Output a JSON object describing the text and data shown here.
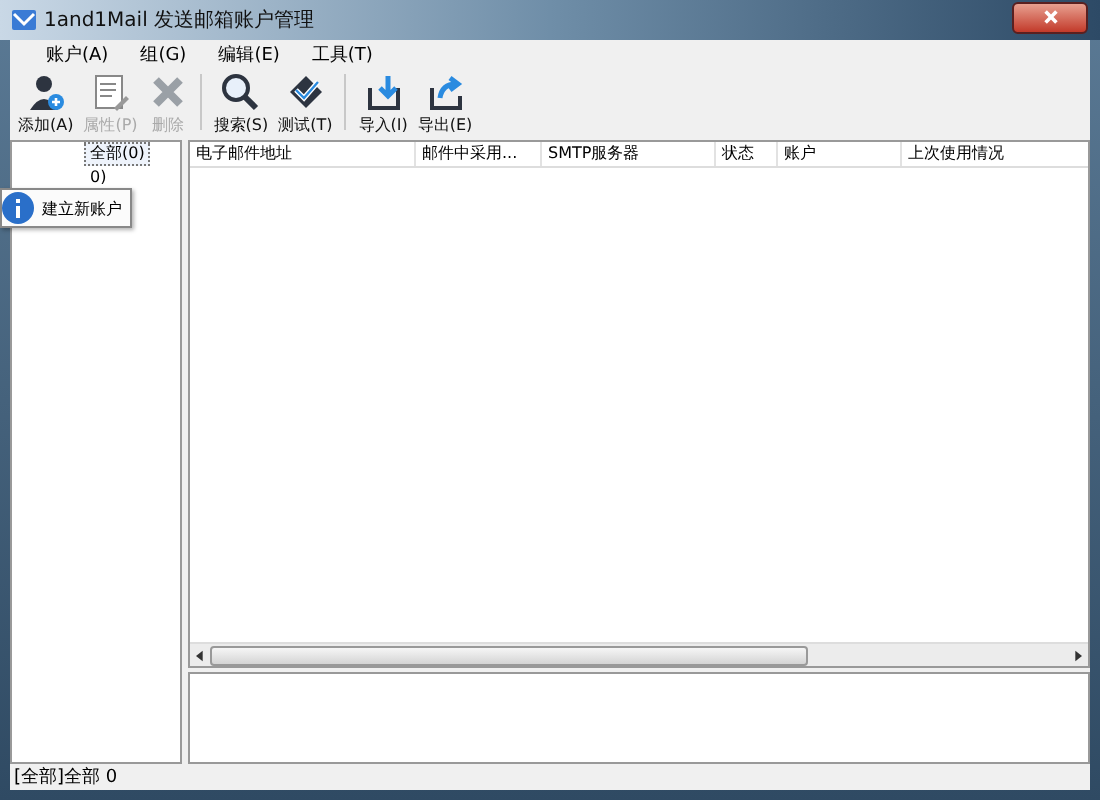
{
  "window": {
    "title": "1and1Mail 发送邮箱账户管理"
  },
  "menu": [
    "账户(A)",
    "组(G)",
    "编辑(E)",
    "工具(T)"
  ],
  "toolbar": [
    {
      "label": "添加(A)",
      "kind": "add",
      "disabled": false
    },
    {
      "label": "属性(P)",
      "kind": "props",
      "disabled": true
    },
    {
      "label": "删除",
      "kind": "delete",
      "disabled": true
    },
    {
      "kind": "separator"
    },
    {
      "label": "搜索(S)",
      "kind": "search",
      "disabled": false
    },
    {
      "label": "测试(T)",
      "kind": "test",
      "disabled": false
    },
    {
      "kind": "separator"
    },
    {
      "label": "导入(I)",
      "kind": "import",
      "disabled": false
    },
    {
      "label": "导出(E)",
      "kind": "export",
      "disabled": false
    }
  ],
  "tree": [
    {
      "label": "全部(0)",
      "selected": true
    },
    {
      "label": "0)",
      "selected": false
    }
  ],
  "tooltip": "建立新账户",
  "table": {
    "columns": [
      "电子邮件地址",
      "邮件中采用...",
      "SMTP服务器",
      "状态",
      "账户",
      "上次使用情况"
    ]
  },
  "status_bar": "[全部]全部 0"
}
